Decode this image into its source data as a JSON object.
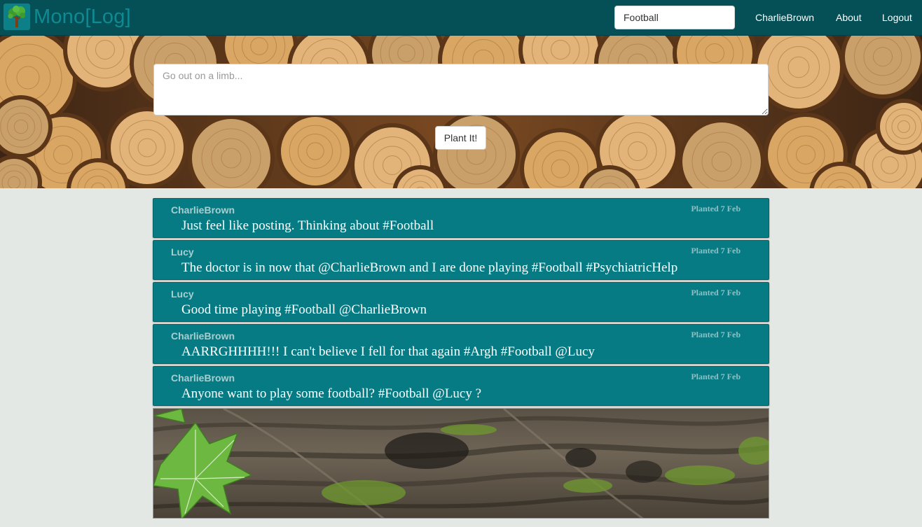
{
  "brand": {
    "name": "Mono[Log]",
    "logo_icon": "tree-icon"
  },
  "search": {
    "value": "Football"
  },
  "nav": {
    "user": "CharlieBrown",
    "about": "About",
    "logout": "Logout"
  },
  "composer": {
    "placeholder": "Go out on a limb...",
    "submit_label": "Plant It!"
  },
  "posts": [
    {
      "author": "CharlieBrown",
      "date": "Planted 7 Feb",
      "text": "Just feel like posting. Thinking about #Football"
    },
    {
      "author": "Lucy",
      "date": "Planted 7 Feb",
      "text": "The doctor is in now that @CharlieBrown and I are done playing #Football #PsychiatricHelp"
    },
    {
      "author": "Lucy",
      "date": "Planted 7 Feb",
      "text": "Good time playing #Football @CharlieBrown"
    },
    {
      "author": "CharlieBrown",
      "date": "Planted 7 Feb",
      "text": "AARRGHHHH!!! I can't believe I fell for that again #Argh #Football @Lucy"
    },
    {
      "author": "CharlieBrown",
      "date": "Planted 7 Feb",
      "text": "Anyone want to play some football? #Football @Lucy ?"
    }
  ],
  "colors": {
    "navbar": "#054f56",
    "post_background": "#077b83",
    "page_background": "#e4e8e4",
    "brand_text": "#0e8b92"
  }
}
